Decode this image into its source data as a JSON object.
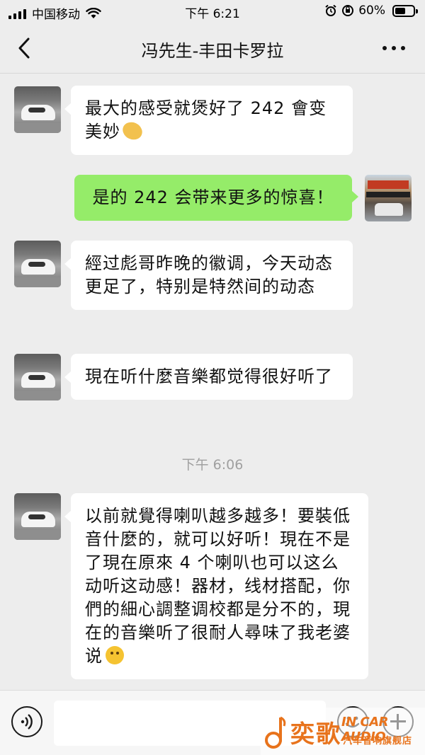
{
  "status_bar": {
    "carrier": "中国移动",
    "time": "下午 6:21",
    "battery_text": "60%",
    "battery_level": 0.6
  },
  "nav": {
    "title": "冯先生-丰田卡罗拉"
  },
  "messages": [
    {
      "side": "left",
      "text": "最大的感受就煲好了 242 會变美妙",
      "emoji": "hand-icon"
    },
    {
      "side": "right",
      "text": "是的 242 会带来更多的惊喜！"
    },
    {
      "side": "left",
      "text": "經过彪哥昨晚的徽调，今天动态更足了，特别是特然间的动态"
    },
    {
      "side": "left",
      "text": "現在听什麼音樂都觉得很好听了"
    },
    {
      "side": "left",
      "text": "以前就覺得喇叭越多越多！要裝低音什麼的，就可以好听！現在不是了現在原來 4 个喇叭也可以这么动听这动感！器材，线材搭配，你們的細心調整调校都是分不的，現在的音樂听了很耐人尋味了我老婆说",
      "emoji": "thinking-face-icon"
    }
  ],
  "timestamp": "下午 6:06",
  "input": {
    "value": "",
    "placeholder": ""
  },
  "watermark": {
    "brand": "奕歌",
    "english": "IN CAR AUDIO",
    "subtitle": "汽车音响旗舰店"
  },
  "colors": {
    "background": "#ededed",
    "bubble_self": "#95ec69",
    "bubble_other": "#ffffff",
    "watermark": "#e8731c"
  }
}
